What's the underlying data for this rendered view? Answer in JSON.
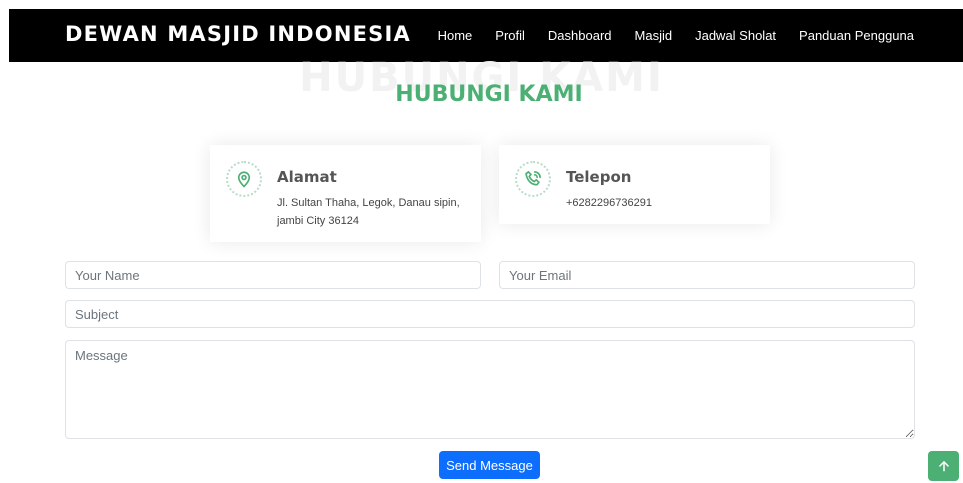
{
  "navbar": {
    "brand": "DEWAN MASJID INDONESIA",
    "links": [
      "Home",
      "Profil",
      "Dashboard",
      "Masjid",
      "Jadwal Sholat",
      "Panduan Pengguna"
    ]
  },
  "section": {
    "background_title": "HUBUNGI KAMI",
    "title": "HUBUNGI KAMI"
  },
  "address_card": {
    "icon": "map-pin-icon",
    "title": "Alamat",
    "text": "Jl. Sultan Thaha, Legok, Danau sipin, jambi City 36124"
  },
  "phone_card": {
    "icon": "phone-icon",
    "title": "Telepon",
    "text": "+6282296736291"
  },
  "form": {
    "name_placeholder": "Your Name",
    "email_placeholder": "Your Email",
    "subject_placeholder": "Subject",
    "message_placeholder": "Message",
    "send_label": "Send Message"
  },
  "back_to_top": {
    "icon": "arrow-up-icon"
  },
  "colors": {
    "accent": "#4caf74",
    "primary": "#0d6efd",
    "nav_bg": "#000000"
  }
}
